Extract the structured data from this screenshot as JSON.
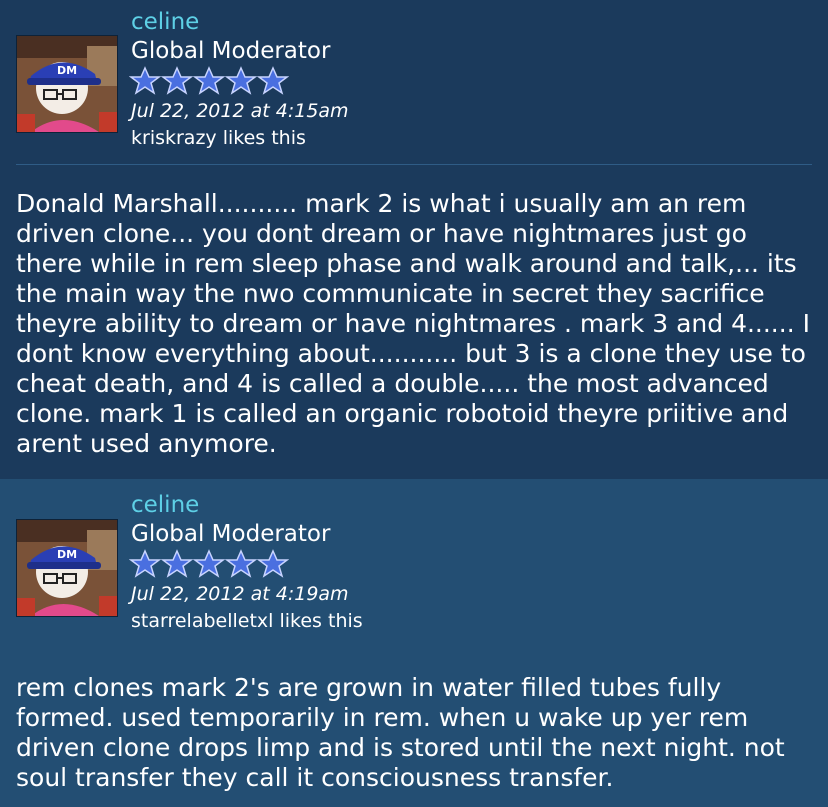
{
  "posts": [
    {
      "username": "celine",
      "role": "Global Moderator",
      "rating_stars": 5,
      "timestamp": "Jul 22, 2012 at 4:15am",
      "likes": "kriskrazy likes this",
      "body": "Donald Marshall.......... mark 2 is what i usually am an rem driven clone... you dont dream or have nightmares just go there while in rem sleep phase and walk around and talk,... its the main way the nwo communicate in secret they sacrifice theyre ability to dream or have nightmares . mark 3 and 4...... I dont know everything about........... but 3 is a clone they use to cheat death, and 4 is called a double..... the most advanced clone. mark 1 is called an organic robotoid theyre priitive and arent used anymore."
    },
    {
      "username": "celine",
      "role": "Global Moderator",
      "rating_stars": 5,
      "timestamp": "Jul 22, 2012 at 4:19am",
      "likes": "starrelabelletxl likes this",
      "body": "rem clones mark 2's are grown in water filled tubes fully formed. used temporarily in rem. when u wake up yer rem driven clone drops limp and is stored until the next night. not soul transfer they call it consciousness transfer."
    }
  ],
  "colors": {
    "post_bg_1": "#1b3a5c",
    "post_bg_2": "#234e73",
    "username": "#5ed0e6",
    "text": "#ffffff",
    "star": "#4a6fe0"
  },
  "icons": {
    "avatar": "cartoon-avatar-icon",
    "star": "star-icon"
  }
}
